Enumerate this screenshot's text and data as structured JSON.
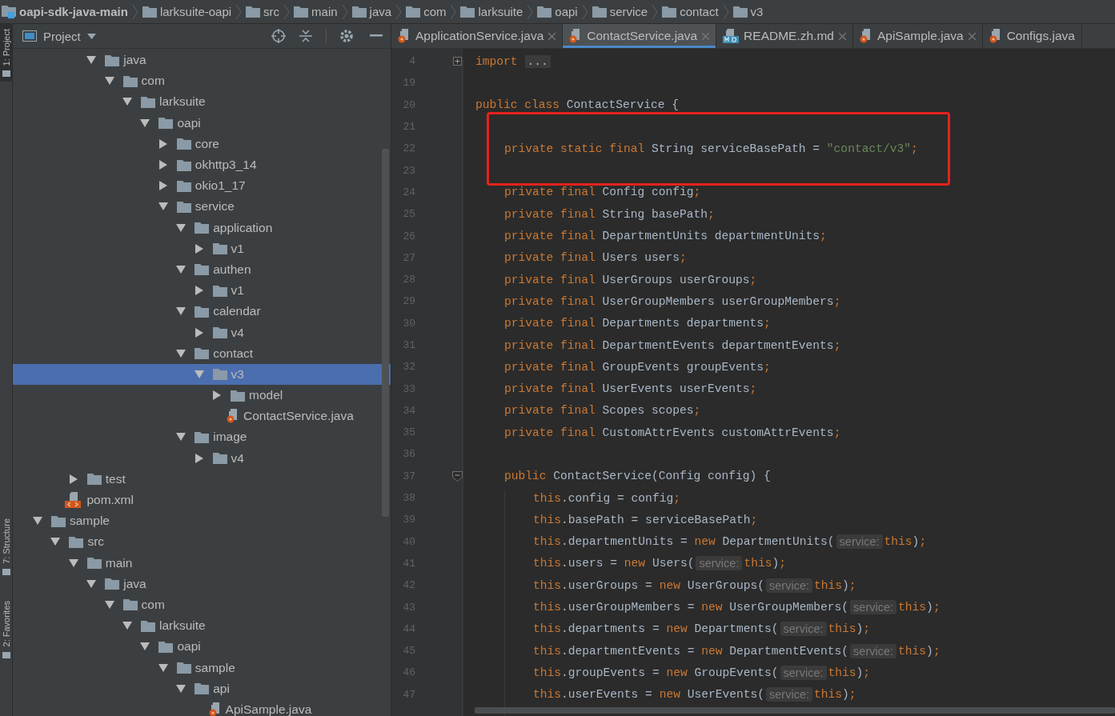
{
  "breadcrumbs": [
    {
      "label": "oapi-sdk-java-main",
      "kind": "module"
    },
    {
      "label": "larksuite-oapi",
      "kind": "folder"
    },
    {
      "label": "src",
      "kind": "folder"
    },
    {
      "label": "main",
      "kind": "folder"
    },
    {
      "label": "java",
      "kind": "folder"
    },
    {
      "label": "com",
      "kind": "folder"
    },
    {
      "label": "larksuite",
      "kind": "folder"
    },
    {
      "label": "oapi",
      "kind": "folder"
    },
    {
      "label": "service",
      "kind": "folder"
    },
    {
      "label": "contact",
      "kind": "folder"
    },
    {
      "label": "v3",
      "kind": "folder"
    }
  ],
  "side_stripe": [
    {
      "label": "1: Project",
      "selected": true
    },
    {
      "label": "7: Structure",
      "selected": false
    },
    {
      "label": "2: Favorites",
      "selected": false
    }
  ],
  "project_panel": {
    "title": "Project",
    "tree": [
      {
        "kind": "scrolled",
        "children": [
          {
            "kind": "scrolled",
            "children": [
              {
                "kind": "scrolled",
                "children": [
                  {
                    "kind": "folder",
                    "label": "java",
                    "expanded": true,
                    "selected": false,
                    "children": [
                      {
                        "kind": "folder",
                        "label": "com",
                        "expanded": true,
                        "selected": false,
                        "children": [
                          {
                            "kind": "folder",
                            "label": "larksuite",
                            "expanded": true,
                            "selected": false,
                            "children": [
                              {
                                "kind": "folder",
                                "label": "oapi",
                                "expanded": true,
                                "selected": false,
                                "children": [
                                  {
                                    "kind": "folder",
                                    "label": "core",
                                    "expanded": false,
                                    "selected": false
                                  },
                                  {
                                    "kind": "folder",
                                    "label": "okhttp3_14",
                                    "expanded": false,
                                    "selected": false
                                  },
                                  {
                                    "kind": "folder",
                                    "label": "okio1_17",
                                    "expanded": false,
                                    "selected": false
                                  },
                                  {
                                    "kind": "folder",
                                    "label": "service",
                                    "expanded": true,
                                    "selected": false,
                                    "children": [
                                      {
                                        "kind": "folder",
                                        "label": "application",
                                        "expanded": true,
                                        "selected": false,
                                        "children": [
                                          {
                                            "kind": "folder",
                                            "label": "v1",
                                            "expanded": false,
                                            "selected": false
                                          }
                                        ]
                                      },
                                      {
                                        "kind": "folder",
                                        "label": "authen",
                                        "expanded": true,
                                        "selected": false,
                                        "children": [
                                          {
                                            "kind": "folder",
                                            "label": "v1",
                                            "expanded": false,
                                            "selected": false
                                          }
                                        ]
                                      },
                                      {
                                        "kind": "folder",
                                        "label": "calendar",
                                        "expanded": true,
                                        "selected": false,
                                        "children": [
                                          {
                                            "kind": "folder",
                                            "label": "v4",
                                            "expanded": false,
                                            "selected": false
                                          }
                                        ]
                                      },
                                      {
                                        "kind": "folder",
                                        "label": "contact",
                                        "expanded": true,
                                        "selected": false,
                                        "children": [
                                          {
                                            "kind": "folder",
                                            "label": "v3",
                                            "expanded": true,
                                            "selected": true,
                                            "children": [
                                              {
                                                "kind": "folder",
                                                "label": "model",
                                                "expanded": false,
                                                "selected": false
                                              },
                                              {
                                                "kind": "java",
                                                "label": "ContactService.java",
                                                "selected": false
                                              }
                                            ]
                                          }
                                        ]
                                      },
                                      {
                                        "kind": "folder",
                                        "label": "image",
                                        "expanded": true,
                                        "selected": false,
                                        "children": [
                                          {
                                            "kind": "folder",
                                            "label": "v4",
                                            "expanded": false,
                                            "selected": false
                                          }
                                        ]
                                      }
                                    ]
                                  }
                                ]
                              }
                            ]
                          }
                        ]
                      }
                    ]
                  }
                ]
              },
              {
                "kind": "folder",
                "label": "test",
                "expanded": false,
                "selected": false
              }
            ]
          },
          {
            "kind": "xml",
            "label": "pom.xml",
            "selected": false
          }
        ]
      },
      {
        "kind": "folder",
        "label": "sample",
        "expanded": true,
        "selected": false,
        "children": [
          {
            "kind": "folder",
            "label": "src",
            "expanded": true,
            "selected": false,
            "children": [
              {
                "kind": "folder",
                "label": "main",
                "expanded": true,
                "selected": false,
                "children": [
                  {
                    "kind": "folder",
                    "label": "java",
                    "expanded": true,
                    "selected": false,
                    "children": [
                      {
                        "kind": "folder",
                        "label": "com",
                        "expanded": true,
                        "selected": false,
                        "children": [
                          {
                            "kind": "folder",
                            "label": "larksuite",
                            "expanded": true,
                            "selected": false,
                            "children": [
                              {
                                "kind": "folder",
                                "label": "oapi",
                                "expanded": true,
                                "selected": false,
                                "children": [
                                  {
                                    "kind": "folder",
                                    "label": "sample",
                                    "expanded": true,
                                    "selected": false,
                                    "children": [
                                      {
                                        "kind": "folder",
                                        "label": "api",
                                        "expanded": true,
                                        "selected": false,
                                        "children": [
                                          {
                                            "kind": "java",
                                            "label": "ApiSample.java",
                                            "selected": false
                                          }
                                        ]
                                      }
                                    ]
                                  }
                                ]
                              }
                            ]
                          }
                        ]
                      }
                    ]
                  }
                ]
              }
            ]
          }
        ]
      }
    ]
  },
  "tabs": [
    {
      "label": "ApplicationService.java",
      "kind": "java",
      "selected": false,
      "closable": true
    },
    {
      "label": "ContactService.java",
      "kind": "java",
      "selected": true,
      "closable": true
    },
    {
      "label": "README.zh.md",
      "kind": "markdown",
      "selected": false,
      "closable": true
    },
    {
      "label": "ApiSample.java",
      "kind": "java",
      "selected": false,
      "closable": true
    },
    {
      "label": "Configs.java",
      "kind": "java",
      "selected": false,
      "closable": false
    }
  ],
  "code": [
    {
      "number": "4",
      "kind": "top",
      "folded": true,
      "tokens": [
        {
          "kind": "keyword",
          "text": "import"
        },
        {
          "kind": "folded",
          "text": "..."
        }
      ]
    },
    {
      "number": "19",
      "kind": "top"
    },
    {
      "number": "20",
      "kind": "top",
      "tokens": [
        {
          "kind": "keyword",
          "text": "public class"
        },
        {
          "kind": "plain",
          "text": " ContactService {"
        }
      ]
    },
    {
      "number": "21",
      "kind": "member",
      "boxed": true
    },
    {
      "number": "22",
      "kind": "member",
      "boxed": true,
      "tokens": [
        {
          "kind": "keyword",
          "text": "private static final"
        },
        {
          "kind": "plain",
          "text": " String serviceBasePath = "
        },
        {
          "kind": "string",
          "text": "\"contact/v3\""
        },
        {
          "kind": "keyword",
          "text": ";"
        }
      ]
    },
    {
      "number": "23",
      "kind": "member",
      "boxed": true
    },
    {
      "number": "24",
      "kind": "member",
      "tokens": [
        {
          "kind": "keyword",
          "text": "private final"
        },
        {
          "kind": "plain",
          "text": " Config config"
        },
        {
          "kind": "keyword",
          "text": ";"
        }
      ]
    },
    {
      "number": "25",
      "kind": "member",
      "tokens": [
        {
          "kind": "keyword",
          "text": "private final"
        },
        {
          "kind": "plain",
          "text": " String basePath"
        },
        {
          "kind": "keyword",
          "text": ";"
        }
      ]
    },
    {
      "number": "26",
      "kind": "member",
      "tokens": [
        {
          "kind": "keyword",
          "text": "private final"
        },
        {
          "kind": "plain",
          "text": " DepartmentUnits departmentUnits"
        },
        {
          "kind": "keyword",
          "text": ";"
        }
      ]
    },
    {
      "number": "27",
      "kind": "member",
      "tokens": [
        {
          "kind": "keyword",
          "text": "private final"
        },
        {
          "kind": "plain",
          "text": " Users users"
        },
        {
          "kind": "keyword",
          "text": ";"
        }
      ]
    },
    {
      "number": "28",
      "kind": "member",
      "tokens": [
        {
          "kind": "keyword",
          "text": "private final"
        },
        {
          "kind": "plain",
          "text": " UserGroups userGroups"
        },
        {
          "kind": "keyword",
          "text": ";"
        }
      ]
    },
    {
      "number": "29",
      "kind": "member",
      "tokens": [
        {
          "kind": "keyword",
          "text": "private final"
        },
        {
          "kind": "plain",
          "text": " UserGroupMembers userGroupMembers"
        },
        {
          "kind": "keyword",
          "text": ";"
        }
      ]
    },
    {
      "number": "30",
      "kind": "member",
      "tokens": [
        {
          "kind": "keyword",
          "text": "private final"
        },
        {
          "kind": "plain",
          "text": " Departments departments"
        },
        {
          "kind": "keyword",
          "text": ";"
        }
      ]
    },
    {
      "number": "31",
      "kind": "member",
      "tokens": [
        {
          "kind": "keyword",
          "text": "private final"
        },
        {
          "kind": "plain",
          "text": " DepartmentEvents departmentEvents"
        },
        {
          "kind": "keyword",
          "text": ";"
        }
      ]
    },
    {
      "number": "32",
      "kind": "member",
      "tokens": [
        {
          "kind": "keyword",
          "text": "private final"
        },
        {
          "kind": "plain",
          "text": " GroupEvents groupEvents"
        },
        {
          "kind": "keyword",
          "text": ";"
        }
      ]
    },
    {
      "number": "33",
      "kind": "member",
      "tokens": [
        {
          "kind": "keyword",
          "text": "private final"
        },
        {
          "kind": "plain",
          "text": " UserEvents userEvents"
        },
        {
          "kind": "keyword",
          "text": ";"
        }
      ]
    },
    {
      "number": "34",
      "kind": "member",
      "tokens": [
        {
          "kind": "keyword",
          "text": "private final"
        },
        {
          "kind": "plain",
          "text": " Scopes scopes"
        },
        {
          "kind": "keyword",
          "text": ";"
        }
      ]
    },
    {
      "number": "35",
      "kind": "member",
      "tokens": [
        {
          "kind": "keyword",
          "text": "private final"
        },
        {
          "kind": "plain",
          "text": " CustomAttrEvents customAttrEvents"
        },
        {
          "kind": "keyword",
          "text": ";"
        }
      ]
    },
    {
      "number": "36",
      "kind": "member"
    },
    {
      "number": "37",
      "kind": "member",
      "folded": false,
      "tokens": [
        {
          "kind": "keyword",
          "text": "public"
        },
        {
          "kind": "plain",
          "text": " ContactService(Config config) {"
        }
      ]
    },
    {
      "number": "38",
      "kind": "body",
      "tokens": [
        {
          "kind": "keyword",
          "text": "this"
        },
        {
          "kind": "plain",
          "text": ".config = config"
        },
        {
          "kind": "keyword",
          "text": ";"
        }
      ]
    },
    {
      "number": "39",
      "kind": "body",
      "tokens": [
        {
          "kind": "keyword",
          "text": "this"
        },
        {
          "kind": "plain",
          "text": ".basePath = serviceBasePath"
        },
        {
          "kind": "keyword",
          "text": ";"
        }
      ]
    },
    {
      "number": "40",
      "kind": "body",
      "tokens": [
        {
          "kind": "keyword",
          "text": "this"
        },
        {
          "kind": "plain",
          "text": ".departmentUnits = "
        },
        {
          "kind": "keyword",
          "text": "new"
        },
        {
          "kind": "plain",
          "text": " DepartmentUnits("
        },
        {
          "kind": "hint",
          "text": "service:"
        },
        {
          "kind": "keyword",
          "text": "this"
        },
        {
          "kind": "plain",
          "text": ")"
        },
        {
          "kind": "keyword",
          "text": ";"
        }
      ]
    },
    {
      "number": "41",
      "kind": "body",
      "tokens": [
        {
          "kind": "keyword",
          "text": "this"
        },
        {
          "kind": "plain",
          "text": ".users = "
        },
        {
          "kind": "keyword",
          "text": "new"
        },
        {
          "kind": "plain",
          "text": " Users("
        },
        {
          "kind": "hint",
          "text": "service:"
        },
        {
          "kind": "keyword",
          "text": "this"
        },
        {
          "kind": "plain",
          "text": ")"
        },
        {
          "kind": "keyword",
          "text": ";"
        }
      ]
    },
    {
      "number": "42",
      "kind": "body",
      "tokens": [
        {
          "kind": "keyword",
          "text": "this"
        },
        {
          "kind": "plain",
          "text": ".userGroups = "
        },
        {
          "kind": "keyword",
          "text": "new"
        },
        {
          "kind": "plain",
          "text": " UserGroups("
        },
        {
          "kind": "hint",
          "text": "service:"
        },
        {
          "kind": "keyword",
          "text": "this"
        },
        {
          "kind": "plain",
          "text": ")"
        },
        {
          "kind": "keyword",
          "text": ";"
        }
      ]
    },
    {
      "number": "43",
      "kind": "body",
      "tokens": [
        {
          "kind": "keyword",
          "text": "this"
        },
        {
          "kind": "plain",
          "text": ".userGroupMembers = "
        },
        {
          "kind": "keyword",
          "text": "new"
        },
        {
          "kind": "plain",
          "text": " UserGroupMembers("
        },
        {
          "kind": "hint",
          "text": "service:"
        },
        {
          "kind": "keyword",
          "text": "this"
        },
        {
          "kind": "plain",
          "text": ")"
        },
        {
          "kind": "keyword",
          "text": ";"
        }
      ]
    },
    {
      "number": "44",
      "kind": "body",
      "tokens": [
        {
          "kind": "keyword",
          "text": "this"
        },
        {
          "kind": "plain",
          "text": ".departments = "
        },
        {
          "kind": "keyword",
          "text": "new"
        },
        {
          "kind": "plain",
          "text": " Departments("
        },
        {
          "kind": "hint",
          "text": "service:"
        },
        {
          "kind": "keyword",
          "text": "this"
        },
        {
          "kind": "plain",
          "text": ")"
        },
        {
          "kind": "keyword",
          "text": ";"
        }
      ]
    },
    {
      "number": "45",
      "kind": "body",
      "tokens": [
        {
          "kind": "keyword",
          "text": "this"
        },
        {
          "kind": "plain",
          "text": ".departmentEvents = "
        },
        {
          "kind": "keyword",
          "text": "new"
        },
        {
          "kind": "plain",
          "text": " DepartmentEvents("
        },
        {
          "kind": "hint",
          "text": "service:"
        },
        {
          "kind": "keyword",
          "text": "this"
        },
        {
          "kind": "plain",
          "text": ")"
        },
        {
          "kind": "keyword",
          "text": ";"
        }
      ]
    },
    {
      "number": "46",
      "kind": "body",
      "tokens": [
        {
          "kind": "keyword",
          "text": "this"
        },
        {
          "kind": "plain",
          "text": ".groupEvents = "
        },
        {
          "kind": "keyword",
          "text": "new"
        },
        {
          "kind": "plain",
          "text": " GroupEvents("
        },
        {
          "kind": "hint",
          "text": "service:"
        },
        {
          "kind": "keyword",
          "text": "this"
        },
        {
          "kind": "plain",
          "text": ")"
        },
        {
          "kind": "keyword",
          "text": ";"
        }
      ]
    },
    {
      "number": "47",
      "kind": "body",
      "tokens": [
        {
          "kind": "keyword",
          "text": "this"
        },
        {
          "kind": "plain",
          "text": ".userEvents = "
        },
        {
          "kind": "keyword",
          "text": "new"
        },
        {
          "kind": "plain",
          "text": " UserEvents("
        },
        {
          "kind": "hint",
          "text": "service:"
        },
        {
          "kind": "keyword",
          "text": "this"
        },
        {
          "kind": "plain",
          "text": ")"
        },
        {
          "kind": "keyword",
          "text": ";"
        }
      ]
    }
  ]
}
